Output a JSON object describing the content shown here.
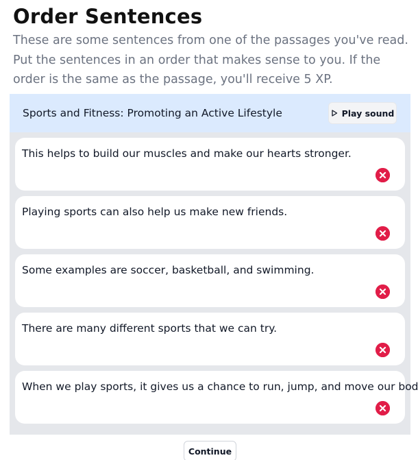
{
  "page": {
    "title": "Order Sentences",
    "instructions": "These are some sentences from one of the passages you've read. Put the sentences in an order that makes sense to you. If the order is the same as the passage, you'll receive 5 XP."
  },
  "passage": {
    "title": "Sports and Fitness: Promoting an Active Lifestyle",
    "play_label": "Play sound",
    "play_icon": "play-icon"
  },
  "sentences": [
    "This helps to build our muscles and make our hearts stronger.",
    "Playing sports can also help us make new friends.",
    "Some examples are soccer, basketball, and swimming.",
    "There are many different sports that we can try.",
    "When we play sports, it gives us a chance to run, jump, and move our bodies."
  ],
  "remove_icon": "close-circle-icon",
  "continue_label": "Continue",
  "colors": {
    "header_bg": "#dbeafe",
    "panel_bg": "#e5e7eb",
    "remove_red": "#e11d48",
    "instruction_gray": "#6b7280"
  }
}
